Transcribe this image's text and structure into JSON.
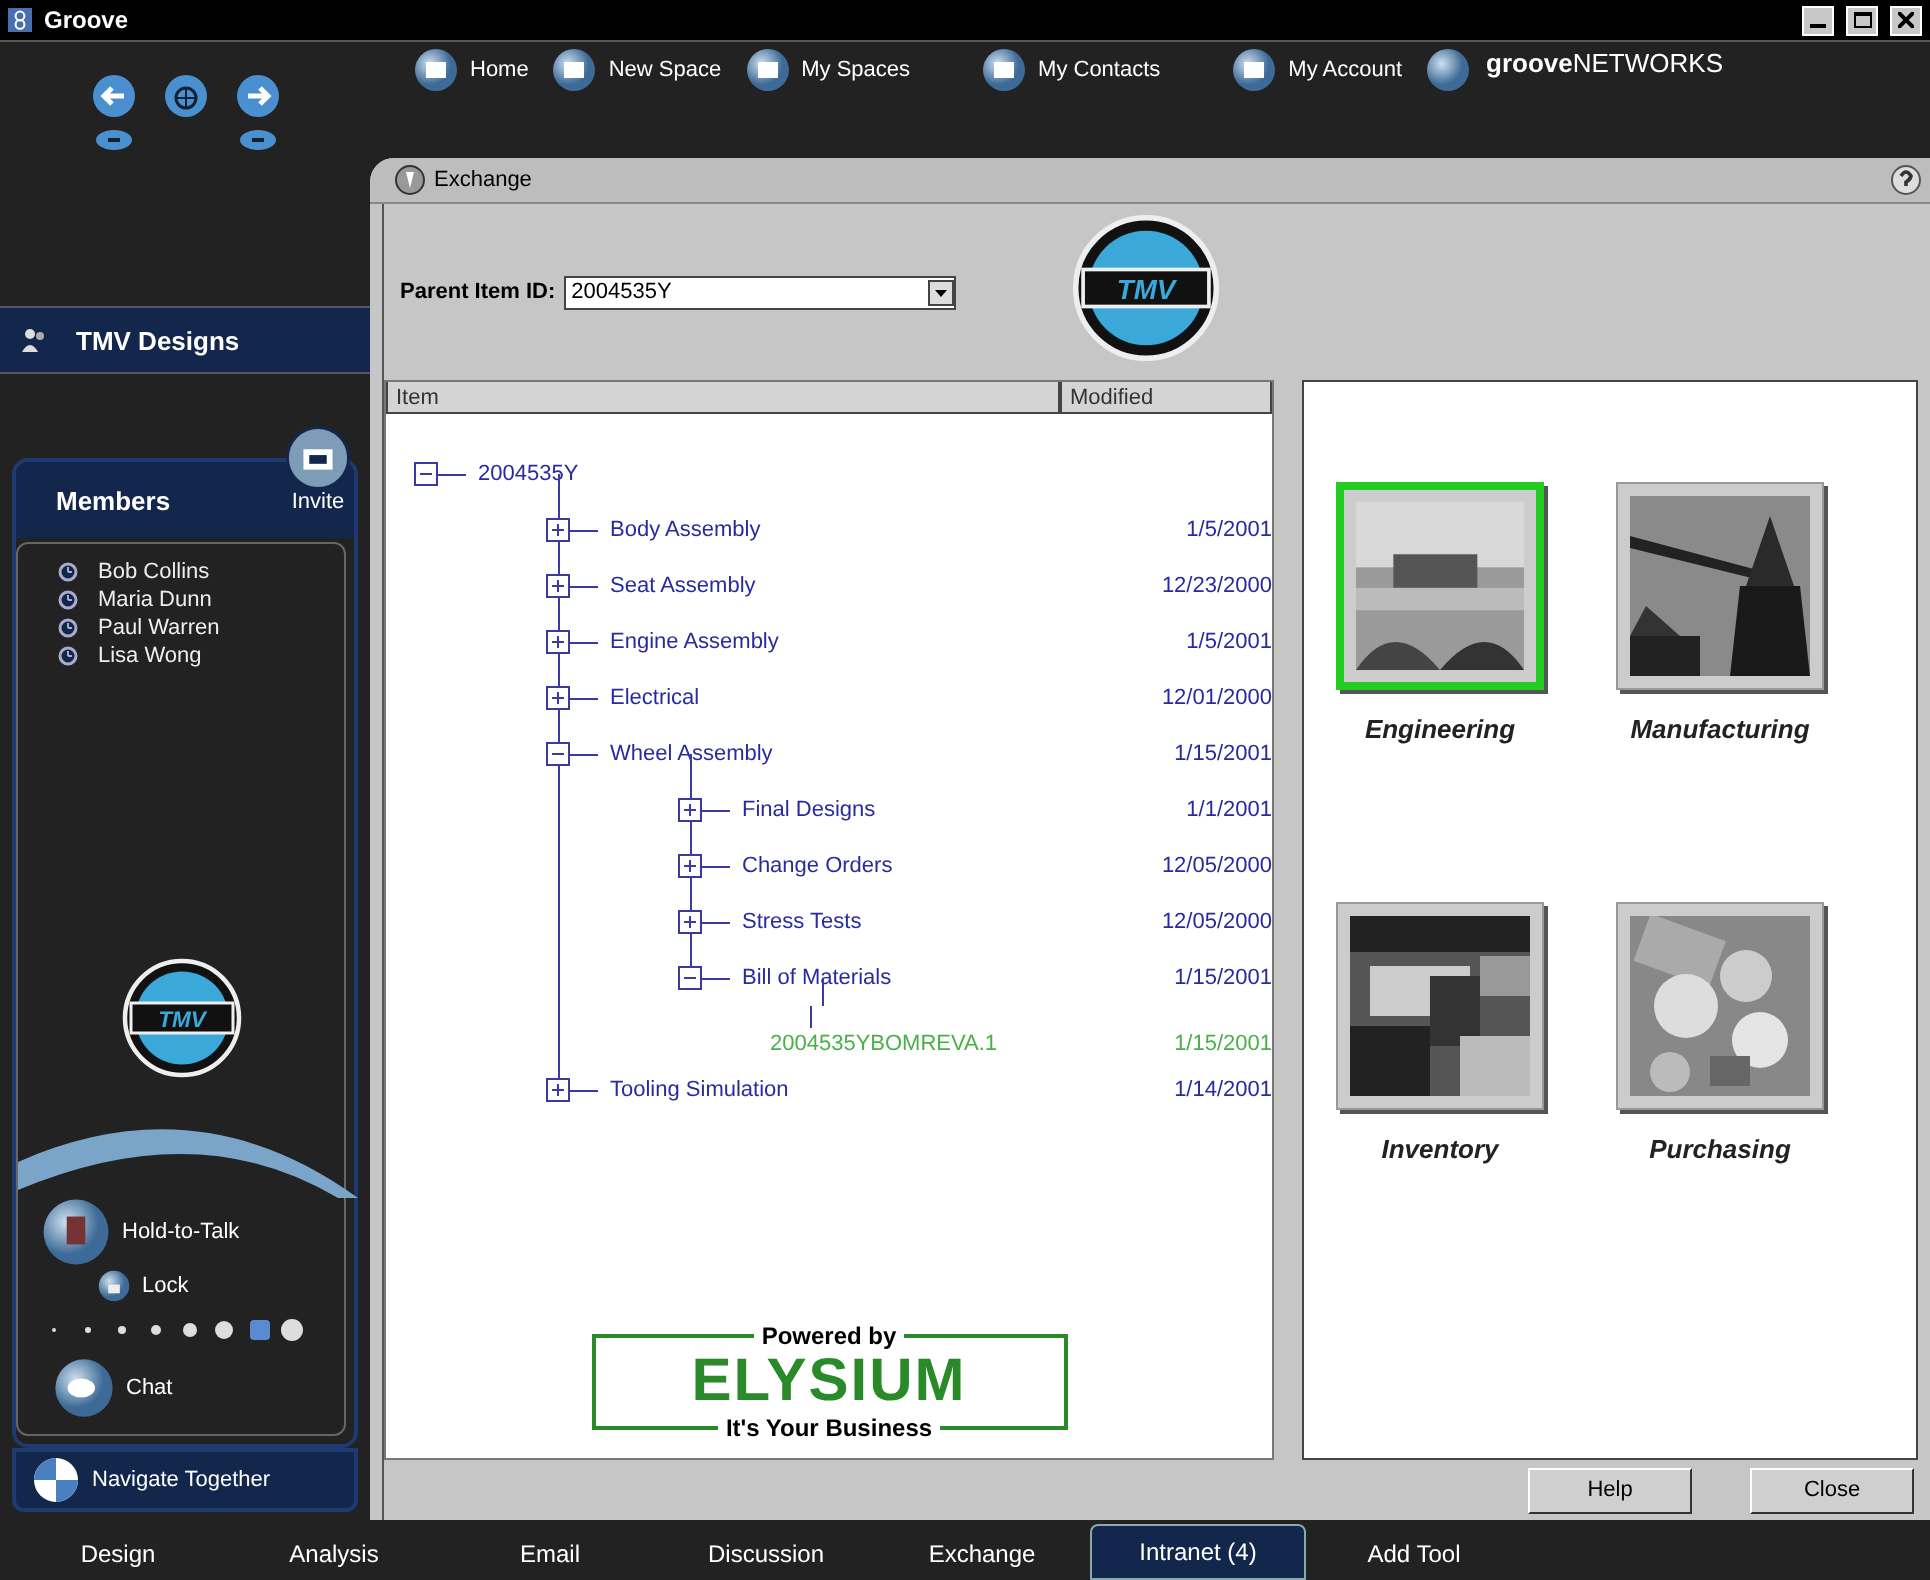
{
  "window": {
    "title": "Groove"
  },
  "sidebar": {
    "space": "TMV Designs",
    "members_title": "Members",
    "invite": "Invite",
    "members": [
      {
        "name": "Bob Collins"
      },
      {
        "name": "Maria Dunn"
      },
      {
        "name": "Paul Warren"
      },
      {
        "name": "Lisa Wong"
      }
    ],
    "logo_text": "TMV",
    "talk": "Hold-to-Talk",
    "lock": "Lock",
    "chat": "Chat",
    "navigate": "Navigate Together"
  },
  "nav": [
    {
      "label": "Home"
    },
    {
      "label": "New Space"
    },
    {
      "label": "My Spaces"
    },
    {
      "label": "My Contacts"
    },
    {
      "label": "My Account"
    }
  ],
  "brand": {
    "bold": "groove",
    "rest": "NETWORKS"
  },
  "tool": {
    "title": "Exchange",
    "parent_label": "Parent Item ID:",
    "parent_value": "2004535Y",
    "logo_text": "TMV"
  },
  "tree": {
    "columns": [
      "Item",
      "Modified"
    ],
    "root": {
      "label": "2004535Y",
      "kind": "folder",
      "expanded": true,
      "children": [
        {
          "label": "Body Assembly",
          "modified": "1/5/2001",
          "kind": "folder",
          "expanded": false
        },
        {
          "label": "Seat Assembly",
          "modified": "12/23/2000",
          "kind": "folder",
          "expanded": false
        },
        {
          "label": "Engine Assembly",
          "modified": "1/5/2001",
          "kind": "folder",
          "expanded": false
        },
        {
          "label": "Electrical",
          "modified": "12/01/2000",
          "kind": "folder",
          "expanded": false
        },
        {
          "label": "Wheel Assembly",
          "modified": "1/15/2001",
          "kind": "folder",
          "expanded": true,
          "children": [
            {
              "label": "Final Designs",
              "modified": "1/1/2001",
              "kind": "folder",
              "expanded": false
            },
            {
              "label": "Change Orders",
              "modified": "12/05/2000",
              "kind": "folder",
              "expanded": false
            },
            {
              "label": "Stress Tests",
              "modified": "12/05/2000",
              "kind": "folder",
              "expanded": false
            },
            {
              "label": "Bill of Materials",
              "modified": "1/15/2001",
              "kind": "folder",
              "expanded": true,
              "children": [
                {
                  "label": "2004535YBOMREVA.1",
                  "modified": "1/15/2001",
                  "kind": "record"
                }
              ]
            }
          ]
        },
        {
          "label": "Tooling Simulation",
          "modified": "1/14/2001",
          "kind": "folder",
          "expanded": false
        }
      ]
    }
  },
  "branding": {
    "top": "Powered by",
    "name": "ELYSIUM",
    "bottom": "It's Your Business"
  },
  "tiles": [
    {
      "label": "Engineering",
      "selected": true,
      "kind": "picture"
    },
    {
      "label": "Manufacturing",
      "selected": false,
      "kind": "picture"
    },
    {
      "label": "Inventory",
      "selected": false,
      "kind": "picture"
    },
    {
      "label": "Purchasing",
      "selected": false,
      "kind": "picture"
    }
  ],
  "buttons": [
    "Help",
    "Close"
  ],
  "tabs": [
    {
      "label": "Design",
      "selected": false
    },
    {
      "label": "Analysis",
      "selected": false
    },
    {
      "label": "Email",
      "selected": false
    },
    {
      "label": "Discussion",
      "selected": false
    },
    {
      "label": "Exchange",
      "selected": false
    },
    {
      "label": "Intranet (4)",
      "selected": true
    },
    {
      "label": "Add Tool",
      "selected": false
    }
  ]
}
